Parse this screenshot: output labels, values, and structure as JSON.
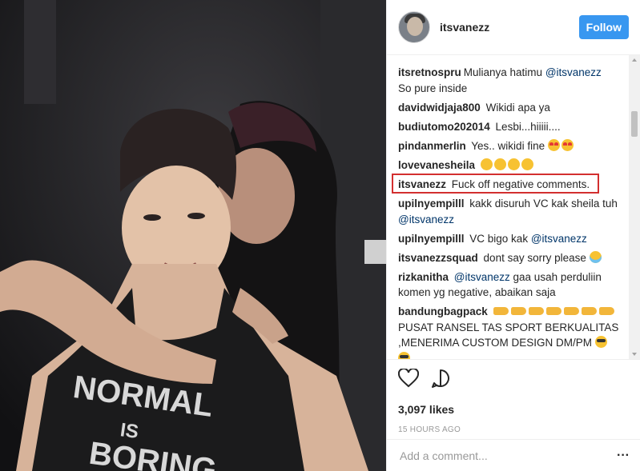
{
  "post": {
    "username": "itsvanezz",
    "follow_label": "Follow",
    "likes": "3,097 likes",
    "timestamp": "15 HOURS AGO",
    "comment_placeholder": "Add a comment...",
    "more_icon": "more-dots-icon",
    "photo_shirt_text": [
      "NORMAL",
      "IS",
      "BORING"
    ]
  },
  "comments": [
    {
      "author": "itsretnospru",
      "text": "Mulianya hatimu ",
      "mention": "@itsvanezz",
      "text2": " So pure inside"
    },
    {
      "author": "davidwidjaja800",
      "text": "Wikidi apa ya"
    },
    {
      "author": "budiutomo202014",
      "text": "Lesbi...hiiiii...."
    },
    {
      "author": "pindanmerlin",
      "text": "Yes.. wikidi fine "
    },
    {
      "author": "lovevanesheila",
      "text": ""
    },
    {
      "author": "itsvanezz",
      "text": "Fuck off negative comments."
    },
    {
      "author": "upilnyempilll",
      "text": "kakk disuruh VC kak sheila tuh ",
      "mention": "@itsvanezz"
    },
    {
      "author": "upilnyempilll",
      "text": "VC bigo kak ",
      "mention": "@itsvanezz"
    },
    {
      "author": "itsvanezzsquad",
      "text": "dont say sorry please "
    },
    {
      "author": "rizkanitha",
      "text": " gaa usah perduliin komen yg negative, abaikan saja",
      "mention_first": "@itsvanezz"
    },
    {
      "author": "bandungbagpack",
      "text": " PUSAT RANSEL TAS SPORT BERKUALITAS ,MENERIMA CUSTOM DESIGN DM/PM "
    }
  ],
  "icons": {
    "like": "heart-icon",
    "comment": "comment-bubble-icon"
  },
  "colors": {
    "follow_button": "#3897f0",
    "highlight_box": "#d32f2f",
    "mention": "#003569"
  }
}
